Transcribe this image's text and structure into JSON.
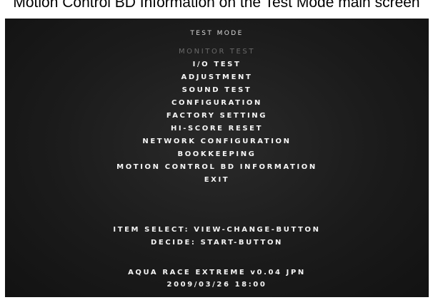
{
  "caption": "Motion Control BD Information on the Test Mode main screen",
  "screen": {
    "title": "TEST MODE",
    "menu": [
      {
        "label": "MONITOR TEST",
        "dim": true
      },
      {
        "label": "I/O TEST"
      },
      {
        "label": "ADJUSTMENT"
      },
      {
        "label": "SOUND TEST"
      },
      {
        "label": "CONFIGURATION"
      },
      {
        "label": "FACTORY SETTING"
      },
      {
        "label": "HI-SCORE RESET"
      },
      {
        "label": "NETWORK CONFIGURATION"
      },
      {
        "label": "BOOKKEEPING"
      },
      {
        "label": "MOTION CONTROL BD INFORMATION"
      },
      {
        "label": "EXIT"
      }
    ],
    "instructions": {
      "item_select": "ITEM SELECT: VIEW-CHANGE-BUTTON",
      "decide": "DECIDE: START-BUTTON"
    },
    "footer": {
      "version": "AQUA RACE EXTREME v0.04 JPN",
      "datetime": "2009/03/26 18:00"
    }
  }
}
